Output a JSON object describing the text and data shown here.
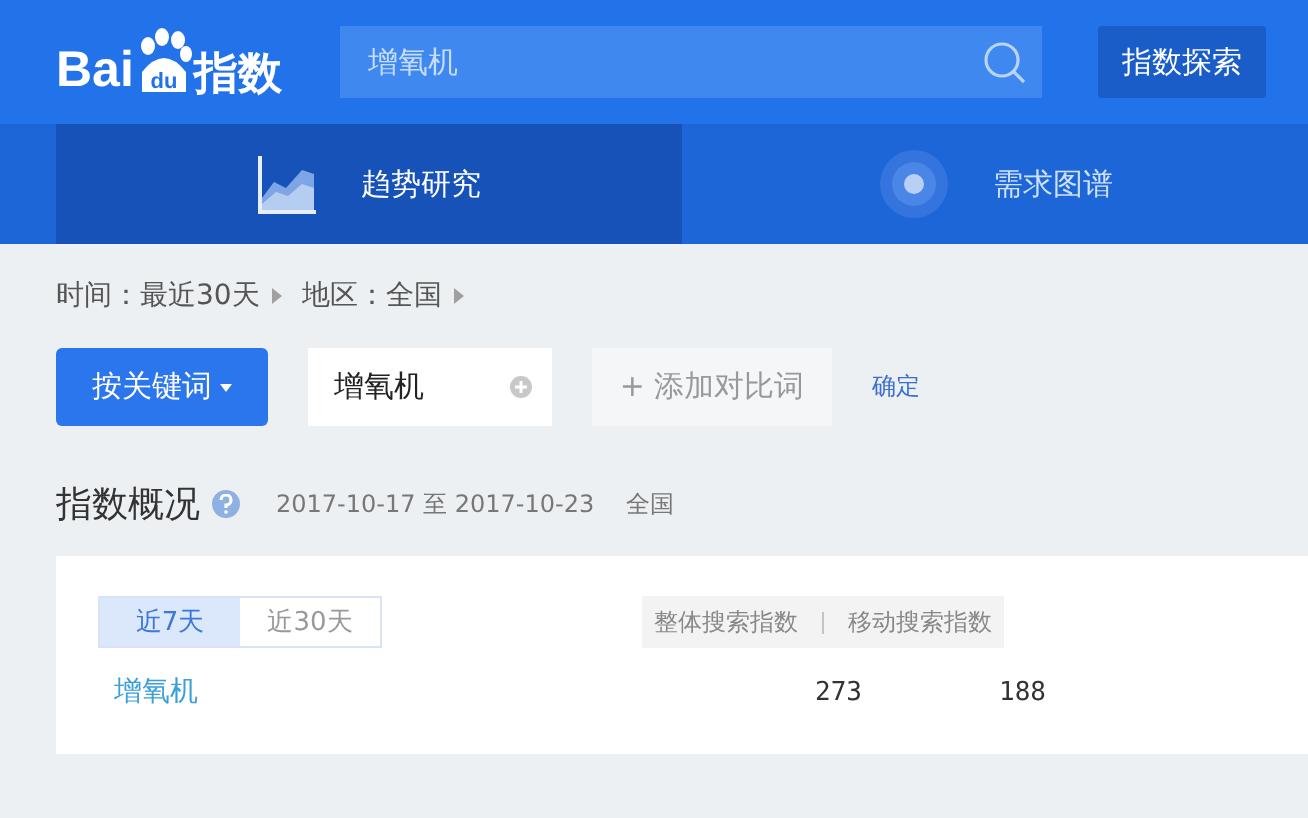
{
  "logo": {
    "parts": [
      "Bai",
      "du",
      "指数"
    ]
  },
  "search": {
    "value": "增氧机"
  },
  "explore_button": "指数探索",
  "nav_tabs": [
    {
      "label": "趋势研究",
      "kind": "trend",
      "selected": true
    },
    {
      "label": "需求图谱",
      "kind": "demand",
      "selected": false
    }
  ],
  "filters": [
    {
      "label": "时间：最近30天"
    },
    {
      "label": "地区：全国"
    }
  ],
  "keyword_bar": {
    "mode_button": "按关键词",
    "keyword": "增氧机",
    "add_compare": "+ 添加对比词",
    "confirm": "确定"
  },
  "overview": {
    "title": "指数概况",
    "date_range": "2017-10-17 至 2017-10-23",
    "region": "全国",
    "periods": [
      {
        "label": "近7天",
        "selected": true
      },
      {
        "label": "近30天",
        "selected": false
      }
    ],
    "columns": [
      "整体搜索指数",
      "移动搜索指数"
    ],
    "rows": [
      {
        "keyword": "增氧机",
        "values": [
          "273",
          "188"
        ]
      }
    ]
  }
}
